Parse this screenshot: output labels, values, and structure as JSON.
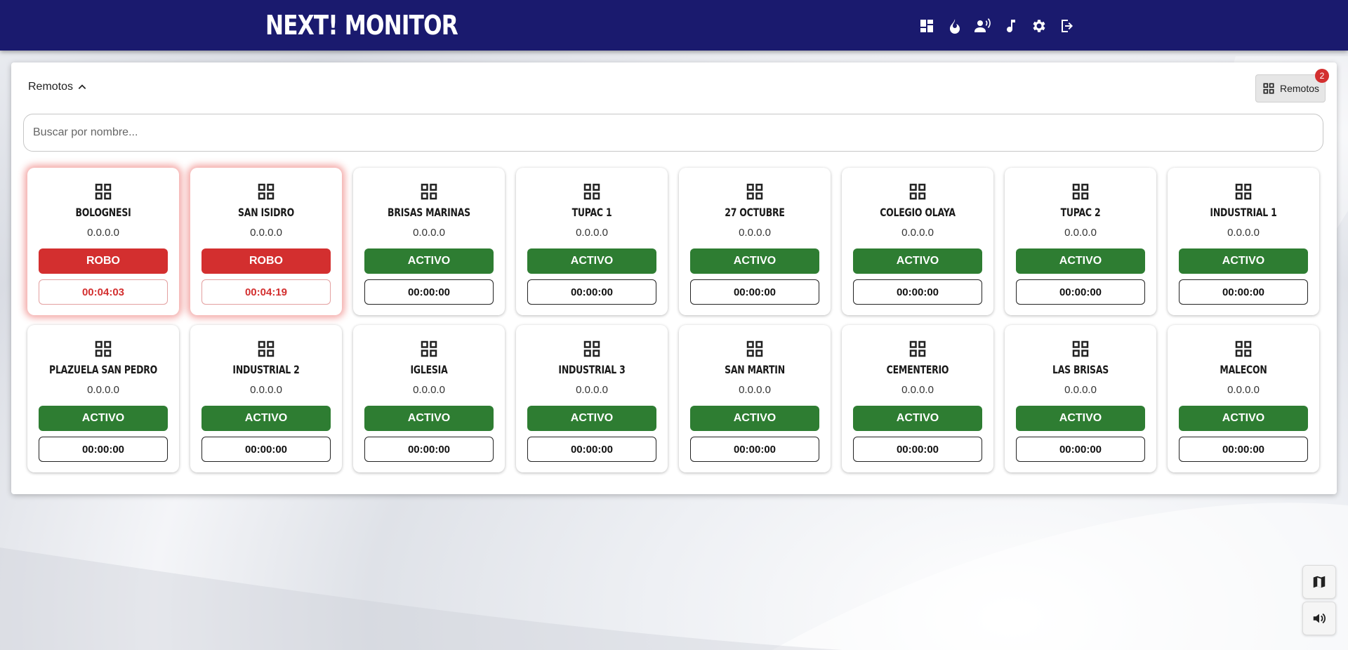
{
  "app": {
    "brand": "NEXT! MONITOR"
  },
  "nav": [
    {
      "name": "dashboard-icon"
    },
    {
      "name": "fire-icon"
    },
    {
      "name": "speaker-person-icon"
    },
    {
      "name": "music-note-icon"
    },
    {
      "name": "gear-icon"
    },
    {
      "name": "logout-icon"
    }
  ],
  "panel": {
    "toggle_label": "Remotos",
    "remotos_button_label": "Remotos",
    "remotos_badge": "2",
    "search_placeholder": "Buscar por nombre..."
  },
  "colors": {
    "topbar": "#1a1a6e",
    "ok": "#2e7d32",
    "alarm": "#d32f2f"
  },
  "remotes": [
    {
      "name": "BOLOGNESI",
      "ip": "0.0.0.0",
      "status": "ROBO",
      "timer": "00:04:03",
      "alarm": true
    },
    {
      "name": "SAN ISIDRO",
      "ip": "0.0.0.0",
      "status": "ROBO",
      "timer": "00:04:19",
      "alarm": true
    },
    {
      "name": "BRISAS MARINAS",
      "ip": "0.0.0.0",
      "status": "ACTIVO",
      "timer": "00:00:00",
      "alarm": false
    },
    {
      "name": "TUPAC 1",
      "ip": "0.0.0.0",
      "status": "ACTIVO",
      "timer": "00:00:00",
      "alarm": false
    },
    {
      "name": "27 OCTUBRE",
      "ip": "0.0.0.0",
      "status": "ACTIVO",
      "timer": "00:00:00",
      "alarm": false
    },
    {
      "name": "COLEGIO OLAYA",
      "ip": "0.0.0.0",
      "status": "ACTIVO",
      "timer": "00:00:00",
      "alarm": false
    },
    {
      "name": "TUPAC 2",
      "ip": "0.0.0.0",
      "status": "ACTIVO",
      "timer": "00:00:00",
      "alarm": false
    },
    {
      "name": "INDUSTRIAL 1",
      "ip": "0.0.0.0",
      "status": "ACTIVO",
      "timer": "00:00:00",
      "alarm": false
    },
    {
      "name": "PLAZUELA SAN PEDRO",
      "ip": "0.0.0.0",
      "status": "ACTIVO",
      "timer": "00:00:00",
      "alarm": false
    },
    {
      "name": "INDUSTRIAL 2",
      "ip": "0.0.0.0",
      "status": "ACTIVO",
      "timer": "00:00:00",
      "alarm": false
    },
    {
      "name": "IGLESIA",
      "ip": "0.0.0.0",
      "status": "ACTIVO",
      "timer": "00:00:00",
      "alarm": false
    },
    {
      "name": "INDUSTRIAL 3",
      "ip": "0.0.0.0",
      "status": "ACTIVO",
      "timer": "00:00:00",
      "alarm": false
    },
    {
      "name": "SAN MARTIN",
      "ip": "0.0.0.0",
      "status": "ACTIVO",
      "timer": "00:00:00",
      "alarm": false
    },
    {
      "name": "CEMENTERIO",
      "ip": "0.0.0.0",
      "status": "ACTIVO",
      "timer": "00:00:00",
      "alarm": false
    },
    {
      "name": "LAS BRISAS",
      "ip": "0.0.0.0",
      "status": "ACTIVO",
      "timer": "00:00:00",
      "alarm": false
    },
    {
      "name": "MALECON",
      "ip": "0.0.0.0",
      "status": "ACTIVO",
      "timer": "00:00:00",
      "alarm": false
    }
  ],
  "floating": [
    {
      "name": "map-icon"
    },
    {
      "name": "volume-icon"
    }
  ]
}
